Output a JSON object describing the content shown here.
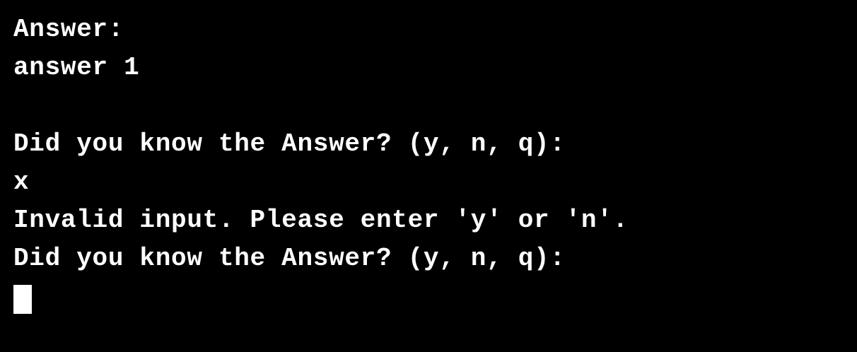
{
  "terminal": {
    "background": "#000000",
    "foreground": "#ffffff",
    "lines": [
      "Answer:",
      "answer 1",
      "",
      "Did you know the Answer? (y, n, q):",
      "x",
      "Invalid input. Please enter 'y' or 'n'.",
      "Did you know the Answer? (y, n, q):"
    ],
    "input_value": ""
  }
}
